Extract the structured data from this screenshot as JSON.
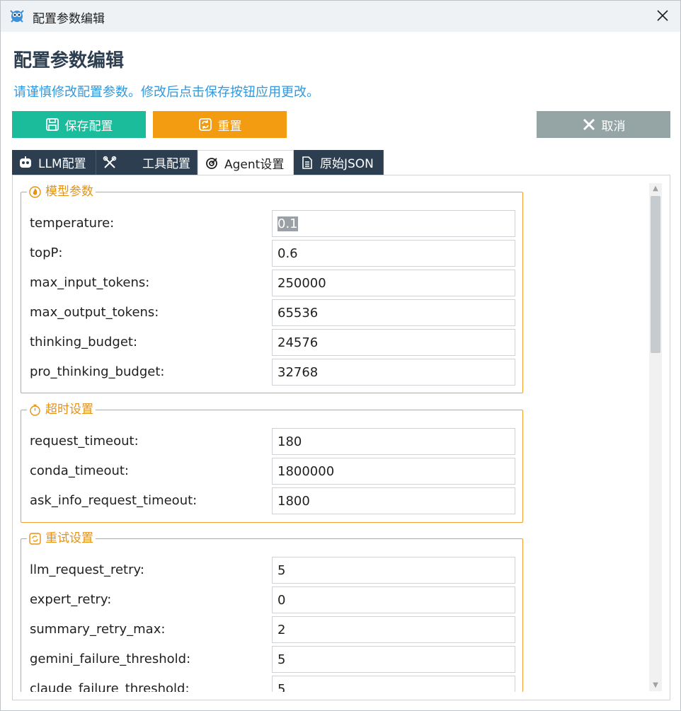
{
  "window": {
    "title": "配置参数编辑"
  },
  "header": {
    "heading": "配置参数编辑",
    "subtitle": "请谨慎修改配置参数。修改后点击保存按钮应用更改。"
  },
  "toolbar": {
    "save_label": "保存配置",
    "reset_label": "重置",
    "cancel_label": "取消"
  },
  "tabs": [
    {
      "label": "LLM配置",
      "icon": "robot-icon"
    },
    {
      "label": "工具配置",
      "icon": "tools-icon"
    },
    {
      "label": "Agent设置",
      "icon": "target-icon",
      "active": true
    },
    {
      "label": "原始JSON",
      "icon": "document-icon"
    }
  ],
  "groups": {
    "model": {
      "title": "模型参数",
      "icon": "flame-icon",
      "fields": [
        {
          "label": "temperature:",
          "value": "0.1"
        },
        {
          "label": "topP:",
          "value": "0.6"
        },
        {
          "label": "max_input_tokens:",
          "value": "250000"
        },
        {
          "label": "max_output_tokens:",
          "value": "65536"
        },
        {
          "label": "thinking_budget:",
          "value": "24576"
        },
        {
          "label": "pro_thinking_budget:",
          "value": "32768"
        }
      ]
    },
    "timeout": {
      "title": "超时设置",
      "icon": "stopwatch-icon",
      "fields": [
        {
          "label": "request_timeout:",
          "value": "180"
        },
        {
          "label": "conda_timeout:",
          "value": "1800000"
        },
        {
          "label": "ask_info_request_timeout:",
          "value": "1800"
        }
      ]
    },
    "retry": {
      "title": "重试设置",
      "icon": "retry-icon",
      "fields": [
        {
          "label": "llm_request_retry:",
          "value": "5"
        },
        {
          "label": "expert_retry:",
          "value": "0"
        },
        {
          "label": "summary_retry_max:",
          "value": "2"
        },
        {
          "label": "gemini_failure_threshold:",
          "value": "5"
        },
        {
          "label": "claude_failure_threshold:",
          "value": "5"
        }
      ]
    }
  },
  "colors": {
    "save": "#1abc9c",
    "reset": "#f39c12",
    "cancel": "#95a5a6",
    "tab_dark": "#2c3e50",
    "group_border": "#f0a030",
    "subtitle": "#3498db"
  }
}
